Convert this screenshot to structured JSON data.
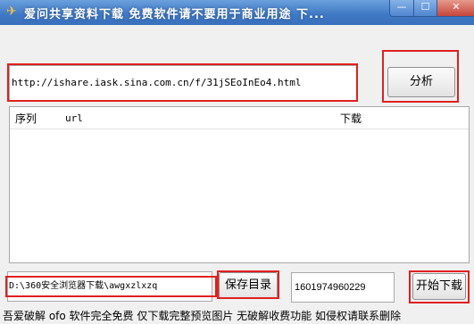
{
  "window": {
    "title": "爱问共享资料下载 免费软件请不要用于商业用途 下...",
    "minimize": "—",
    "maximize": "☐",
    "close": "✕"
  },
  "url_input": {
    "value": "http://ishare.iask.sina.com.cn/f/31jSEoInEo4.html"
  },
  "analyze_button": {
    "label": "分析"
  },
  "list": {
    "columns": [
      "序列",
      "url",
      "下载"
    ],
    "rows": []
  },
  "save_path": {
    "value": "D:\\360安全浏览器下载\\awgxzlxzq"
  },
  "save_dir_button": {
    "label": "保存目录"
  },
  "id_field": {
    "value": "1601974960229"
  },
  "start_button": {
    "label": "开始下载"
  },
  "footer_notice": "吾爱破解 ofo 软件完全免费 仅下载完整预览图片 无破解收费功能 如侵权请联系删除"
}
